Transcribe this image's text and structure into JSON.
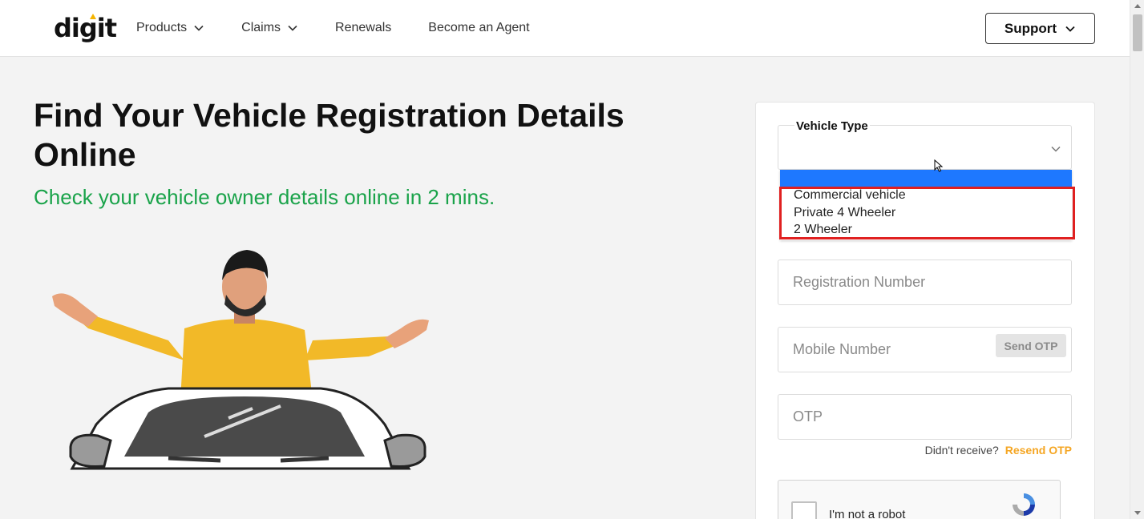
{
  "header": {
    "logo": "digit",
    "nav": [
      {
        "label": "Products",
        "has_dropdown": true
      },
      {
        "label": "Claims",
        "has_dropdown": true
      },
      {
        "label": "Renewals",
        "has_dropdown": false
      },
      {
        "label": "Become an Agent",
        "has_dropdown": false
      }
    ],
    "support_label": "Support"
  },
  "hero": {
    "title": "Find Your Vehicle Registration Details Online",
    "subtitle": "Check your vehicle owner details online in 2 mins."
  },
  "form": {
    "vehicle_type_label": "Vehicle Type",
    "vehicle_type_value": "",
    "vehicle_type_options": [
      "Commercial vehicle",
      "Private 4 Wheeler",
      "2 Wheeler"
    ],
    "registration_placeholder": "Registration Number",
    "mobile_placeholder": "Mobile Number",
    "send_otp_label": "Send OTP",
    "otp_placeholder": "OTP",
    "resend_prompt": "Didn't receive?",
    "resend_label": "Resend OTP",
    "recaptcha_label": "I'm not a robot"
  },
  "colors": {
    "accent_green": "#1aa34a",
    "resend_orange": "#f5a623",
    "selection_blue": "#1e78ff",
    "highlight_red": "#e02020",
    "logo_dot": "#f5b400"
  },
  "icons": {
    "nav_chevron": "chevron-down-icon",
    "recaptcha": "recaptcha-icon",
    "cursor": "mouse-cursor-icon"
  }
}
